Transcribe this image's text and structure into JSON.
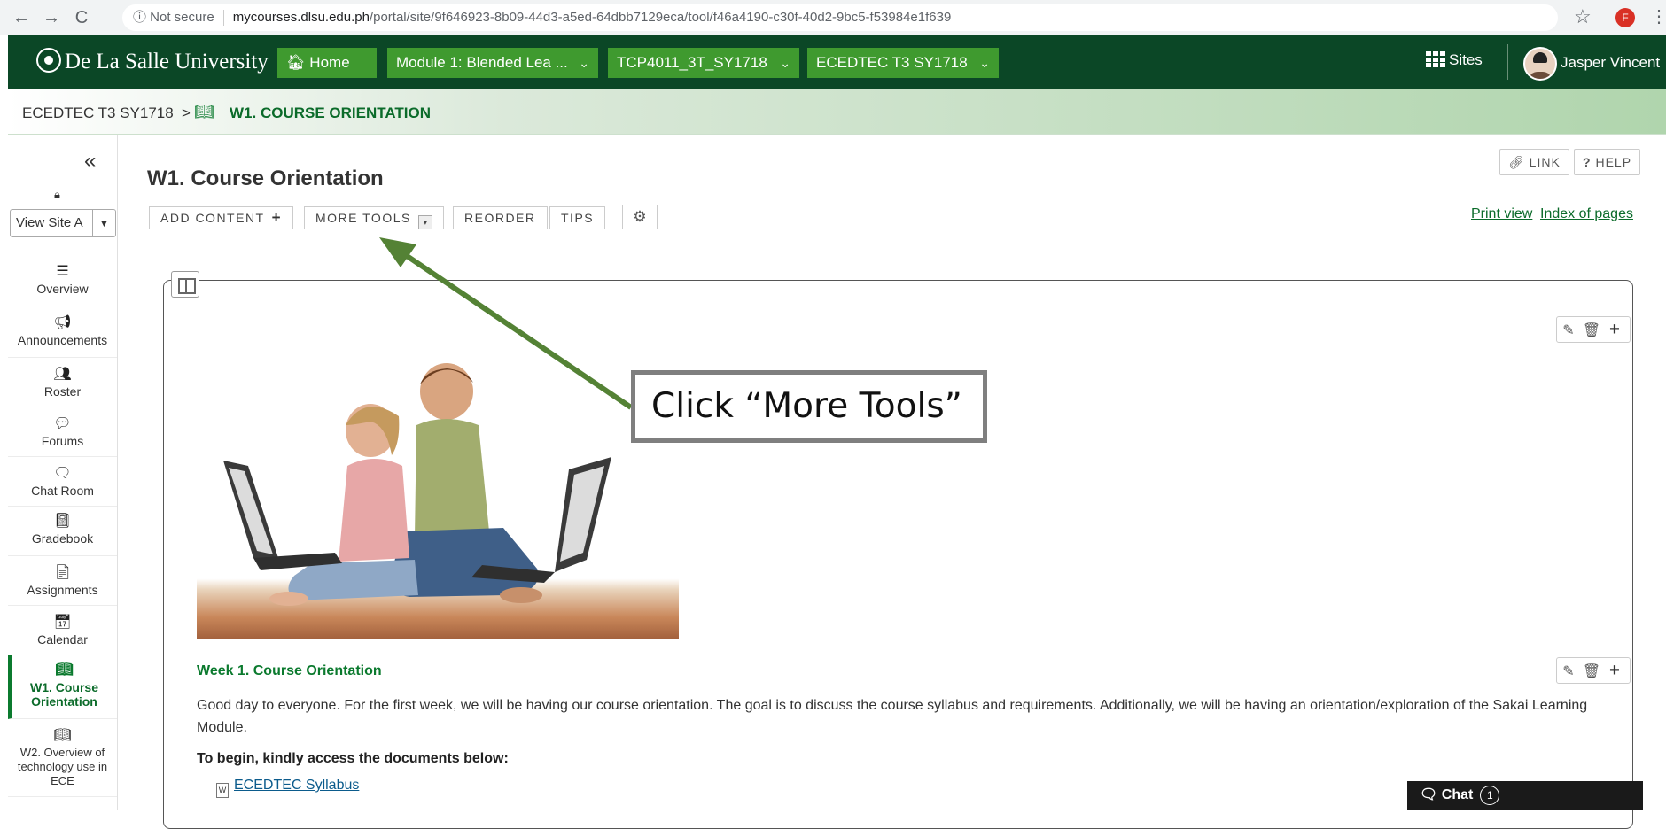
{
  "browser": {
    "back": "←",
    "forward": "→",
    "reload": "C",
    "not_secure": "ⓘ  Not secure",
    "url_host": "mycourses.dlsu.edu.ph",
    "url_path": "/portal/site/9f646923-8b09-44d3-a5ed-64dbb7129eca/tool/f46a4190-c30f-40d2-9bc5-f53984e1f639",
    "star": "☆",
    "profile_initial": "F",
    "menu": "⋮"
  },
  "topnav": {
    "logo": "De La Salle University",
    "home": "🏠︎ Home",
    "module": "Module 1: Blended Lea ...",
    "course_code": "TCP4011_3T_SY1718",
    "course_site": "ECEDTEC T3 SY1718",
    "chevron": "⌄",
    "sites": "Sites",
    "user": "Jasper Vincent"
  },
  "breadcrumb": {
    "site": "ECEDTEC T3 SY1718",
    "sep": ">",
    "page": "W1. COURSE ORIENTATION"
  },
  "sidebar": {
    "collapse": "«",
    "view_site_as": "View Site A",
    "tools": [
      {
        "icon": "☰",
        "label": "Overview"
      },
      {
        "icon": "📢︎",
        "label": "Announcements"
      },
      {
        "icon": "👥︎",
        "label": "Roster"
      },
      {
        "icon": "💬︎",
        "label": "Forums"
      },
      {
        "icon": "🗨︎",
        "label": "Chat Room"
      },
      {
        "icon": "📓︎",
        "label": "Gradebook"
      },
      {
        "icon": "📄︎",
        "label": "Assignments"
      },
      {
        "icon": "📅︎",
        "label": "Calendar"
      },
      {
        "icon": "📖︎",
        "label": "W1. Course Orientation"
      },
      {
        "icon": "📖︎",
        "label": "W2. Overview of technology use in ECE"
      }
    ]
  },
  "main": {
    "title": "W1. Course Orientation",
    "toolbar": {
      "add_content": "ADD CONTENT",
      "more_tools": "MORE TOOLS",
      "reorder": "REORDER",
      "tips": "TIPS",
      "gear": "⚙"
    },
    "link_btn": "LINK",
    "help_btn": "HELP",
    "print_view": "Print view",
    "index_of_pages": "Index of pages",
    "week_heading": "Week 1. Course Orientation",
    "paragraph": "Good day to everyone. For the first week, we will be having our course orientation. The goal is to discuss the course syllabus and requirements. Additionally, we will be having an orientation/exploration of the Sakai Learning Module.",
    "begin": "To begin, kindly access the documents below:",
    "doc_link": "ECEDTEC Syllabus"
  },
  "chat": {
    "label": "Chat",
    "count": "1"
  },
  "annotation": {
    "callout": "Click “More Tools”",
    "arrow_color": "#548235"
  }
}
